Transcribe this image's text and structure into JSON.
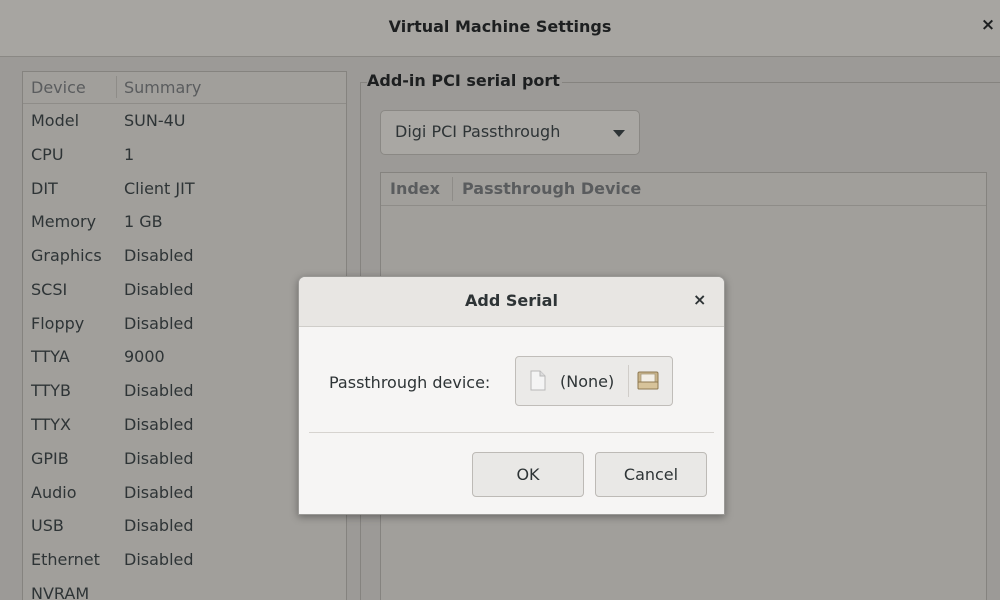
{
  "window": {
    "title": "Virtual Machine Settings",
    "close_glyph": "×"
  },
  "device_list": {
    "headers": {
      "device": "Device",
      "summary": "Summary"
    },
    "rows": [
      {
        "device": "Model",
        "summary": "SUN-4U"
      },
      {
        "device": "CPU",
        "summary": "1"
      },
      {
        "device": "DIT",
        "summary": "Client JIT"
      },
      {
        "device": "Memory",
        "summary": "1 GB"
      },
      {
        "device": "Graphics",
        "summary": "Disabled"
      },
      {
        "device": "SCSI",
        "summary": "Disabled"
      },
      {
        "device": "Floppy",
        "summary": "Disabled"
      },
      {
        "device": "TTYA",
        "summary": "9000"
      },
      {
        "device": "TTYB",
        "summary": "Disabled"
      },
      {
        "device": "TTYX",
        "summary": "Disabled"
      },
      {
        "device": "GPIB",
        "summary": "Disabled"
      },
      {
        "device": "Audio",
        "summary": "Disabled"
      },
      {
        "device": "USB",
        "summary": "Disabled"
      },
      {
        "device": "Ethernet",
        "summary": "Disabled"
      },
      {
        "device": "NVRAM",
        "summary": ""
      }
    ]
  },
  "panel": {
    "frame_label": "Add-in PCI serial port",
    "dropdown_value": "Digi PCI Passthrough",
    "table_headers": {
      "index": "Index",
      "device": "Passthrough Device"
    }
  },
  "dialog": {
    "title": "Add Serial",
    "close_glyph": "×",
    "field_label": "Passthrough device:",
    "file_value": "(None)",
    "ok_label": "OK",
    "cancel_label": "Cancel",
    "icons": {
      "file": "document-icon",
      "browse": "folder-icon"
    }
  }
}
